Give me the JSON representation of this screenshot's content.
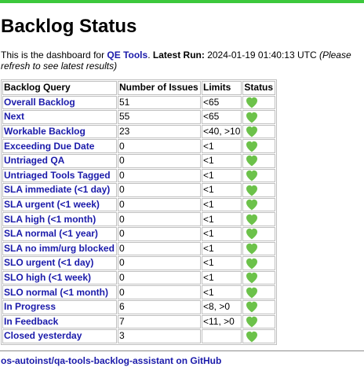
{
  "title": "Backlog Status",
  "intro": {
    "prefix": "This is the dashboard for ",
    "team_link": "QE Tools",
    "sep": ". ",
    "latest_run_label": "Latest Run:",
    "latest_run_value": " 2024-01-19 01:40:13 UTC ",
    "note": "(Please refresh to see latest results)"
  },
  "table": {
    "headers": [
      "Backlog Query",
      "Number of Issues",
      "Limits",
      "Status"
    ],
    "rows": [
      {
        "query": "Overall Backlog",
        "count": "51",
        "limits": "<65",
        "status": "green-heart"
      },
      {
        "query": "Next",
        "count": "55",
        "limits": "<65",
        "status": "green-heart"
      },
      {
        "query": "Workable Backlog",
        "count": "23",
        "limits": "<40, >10",
        "status": "green-heart"
      },
      {
        "query": "Exceeding Due Date",
        "count": "0",
        "limits": "<1",
        "status": "green-heart"
      },
      {
        "query": "Untriaged QA",
        "count": "0",
        "limits": "<1",
        "status": "green-heart"
      },
      {
        "query": "Untriaged Tools Tagged",
        "count": "0",
        "limits": "<1",
        "status": "green-heart"
      },
      {
        "query": "SLA immediate (<1 day)",
        "count": "0",
        "limits": "<1",
        "status": "green-heart"
      },
      {
        "query": "SLA urgent (<1 week)",
        "count": "0",
        "limits": "<1",
        "status": "green-heart"
      },
      {
        "query": "SLA high (<1 month)",
        "count": "0",
        "limits": "<1",
        "status": "green-heart"
      },
      {
        "query": "SLA normal (<1 year)",
        "count": "0",
        "limits": "<1",
        "status": "green-heart"
      },
      {
        "query": "SLA no imm/urg blocked",
        "count": "0",
        "limits": "<1",
        "status": "green-heart"
      },
      {
        "query": "SLO urgent (<1 day)",
        "count": "0",
        "limits": "<1",
        "status": "green-heart"
      },
      {
        "query": "SLO high (<1 week)",
        "count": "0",
        "limits": "<1",
        "status": "green-heart"
      },
      {
        "query": "SLO normal (<1 month)",
        "count": "0",
        "limits": "<1",
        "status": "green-heart"
      },
      {
        "query": "In Progress",
        "count": "6",
        "limits": "<8, >0",
        "status": "green-heart"
      },
      {
        "query": "In Feedback",
        "count": "7",
        "limits": "<11, >0",
        "status": "green-heart"
      },
      {
        "query": "Closed yesterday",
        "count": "3",
        "limits": "",
        "status": "green-heart"
      }
    ]
  },
  "footer": {
    "link_text": "os-autoinst/qa-tools-backlog-assistant on GitHub"
  },
  "colors": {
    "accent_bar": "#3cc83c",
    "link": "#1a1aaa",
    "heart": "#6cc24a"
  }
}
